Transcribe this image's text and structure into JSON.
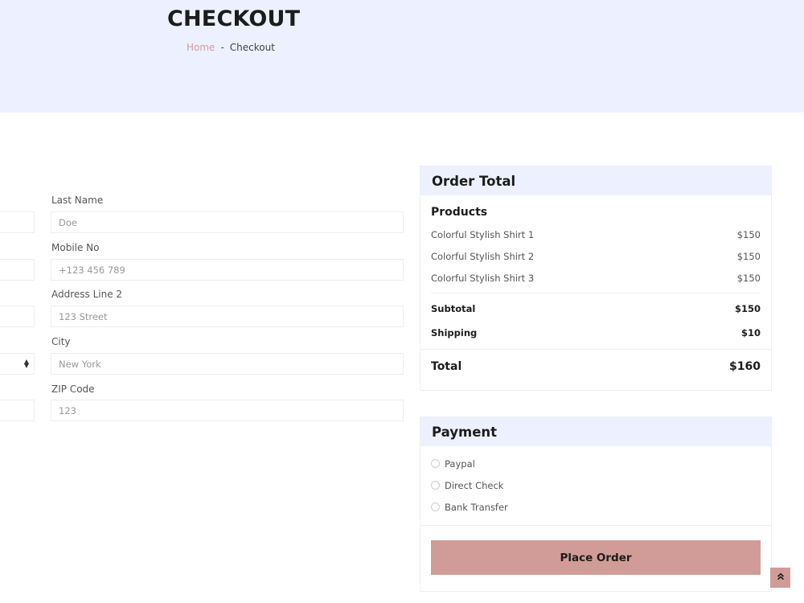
{
  "header": {
    "title": "CHECKOUT",
    "breadcrumb": {
      "home": "Home",
      "separator": "-",
      "current": "Checkout"
    }
  },
  "form": {
    "last_name": {
      "label": "Last Name",
      "placeholder": "Doe"
    },
    "mobile": {
      "label": "Mobile No",
      "placeholder": "+123 456 789"
    },
    "address2": {
      "label": "Address Line 2",
      "placeholder": "123 Street"
    },
    "city": {
      "label": "City",
      "placeholder": "New York"
    },
    "zip": {
      "label": "ZIP Code",
      "placeholder": "123"
    }
  },
  "order_total": {
    "heading": "Order Total",
    "products_title": "Products",
    "products": [
      {
        "name": "Colorful Stylish Shirt 1",
        "price": "$150"
      },
      {
        "name": "Colorful Stylish Shirt 2",
        "price": "$150"
      },
      {
        "name": "Colorful Stylish Shirt 3",
        "price": "$150"
      }
    ],
    "subtotal": {
      "label": "Subtotal",
      "value": "$150"
    },
    "shipping": {
      "label": "Shipping",
      "value": "$10"
    },
    "total": {
      "label": "Total",
      "value": "$160"
    }
  },
  "payment": {
    "heading": "Payment",
    "options": [
      "Paypal",
      "Direct Check",
      "Bank Transfer"
    ],
    "place_order_label": "Place Order"
  },
  "icons": {
    "back_to_top": "double-chevron-up-icon"
  },
  "colors": {
    "accent": "#d19c97",
    "band": "#edf1ff",
    "text": "#1c1c1c"
  }
}
